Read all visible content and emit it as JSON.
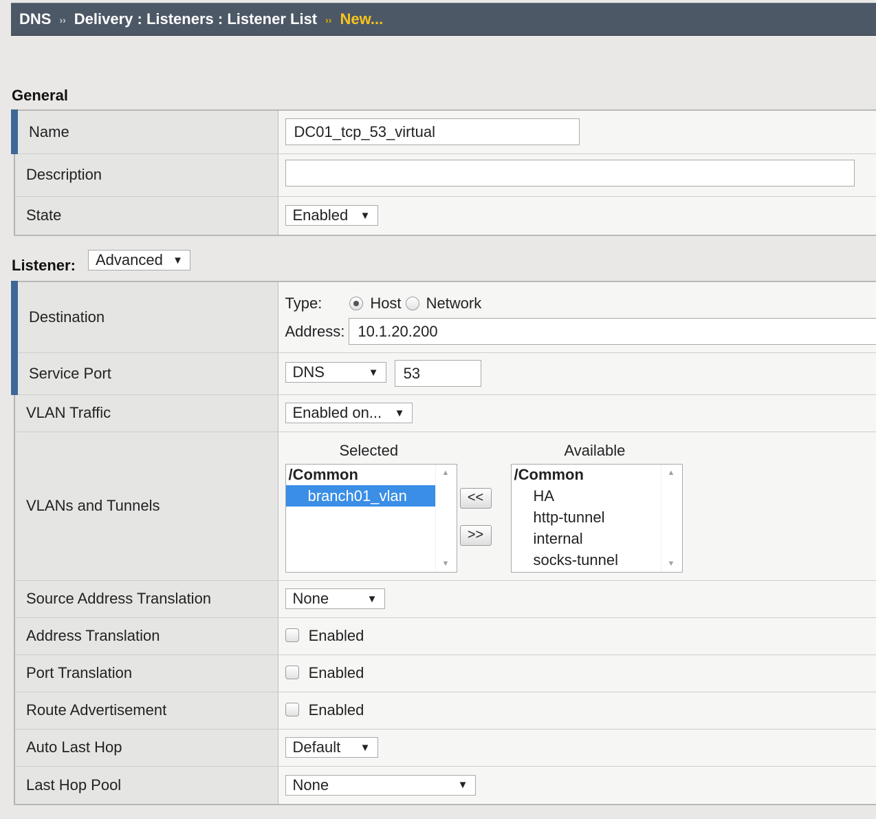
{
  "breadcrumb": {
    "items": [
      "DNS",
      "Delivery : Listeners : Listener List"
    ],
    "current": "New..."
  },
  "general": {
    "title": "General",
    "name_label": "Name",
    "name_value": "DC01_tcp_53_virtual",
    "description_label": "Description",
    "description_value": "",
    "state_label": "State",
    "state_value": "Enabled"
  },
  "listener": {
    "title": "Listener:",
    "mode_value": "Advanced",
    "destination_label": "Destination",
    "type_label": "Type:",
    "type_host": "Host",
    "type_network": "Network",
    "address_label": "Address:",
    "address_value": "10.1.20.200",
    "service_port_label": "Service Port",
    "service_port_select": "DNS",
    "service_port_value": "53",
    "vlan_traffic_label": "VLAN Traffic",
    "vlan_traffic_value": "Enabled on...",
    "vlans_label": "VLANs and Tunnels",
    "selected_header": "Selected",
    "available_header": "Available",
    "selected_group": "/Common",
    "selected_items": [
      "branch01_vlan"
    ],
    "available_group": "/Common",
    "available_items": [
      "HA",
      "http-tunnel",
      "internal",
      "socks-tunnel"
    ],
    "move_left": "<<",
    "move_right": ">>",
    "snat_label": "Source Address Translation",
    "snat_value": "None",
    "addr_trans_label": "Address Translation",
    "addr_trans_check": "Enabled",
    "port_trans_label": "Port Translation",
    "port_trans_check": "Enabled",
    "route_adv_label": "Route Advertisement",
    "route_adv_check": "Enabled",
    "auto_last_hop_label": "Auto Last Hop",
    "auto_last_hop_value": "Default",
    "last_hop_pool_label": "Last Hop Pool",
    "last_hop_pool_value": "None"
  },
  "colors": {
    "header_bg": "#4c5866",
    "current_crumb": "#f7c41d",
    "required_marker": "#3d6797",
    "list_selection": "#3a8ee6"
  }
}
